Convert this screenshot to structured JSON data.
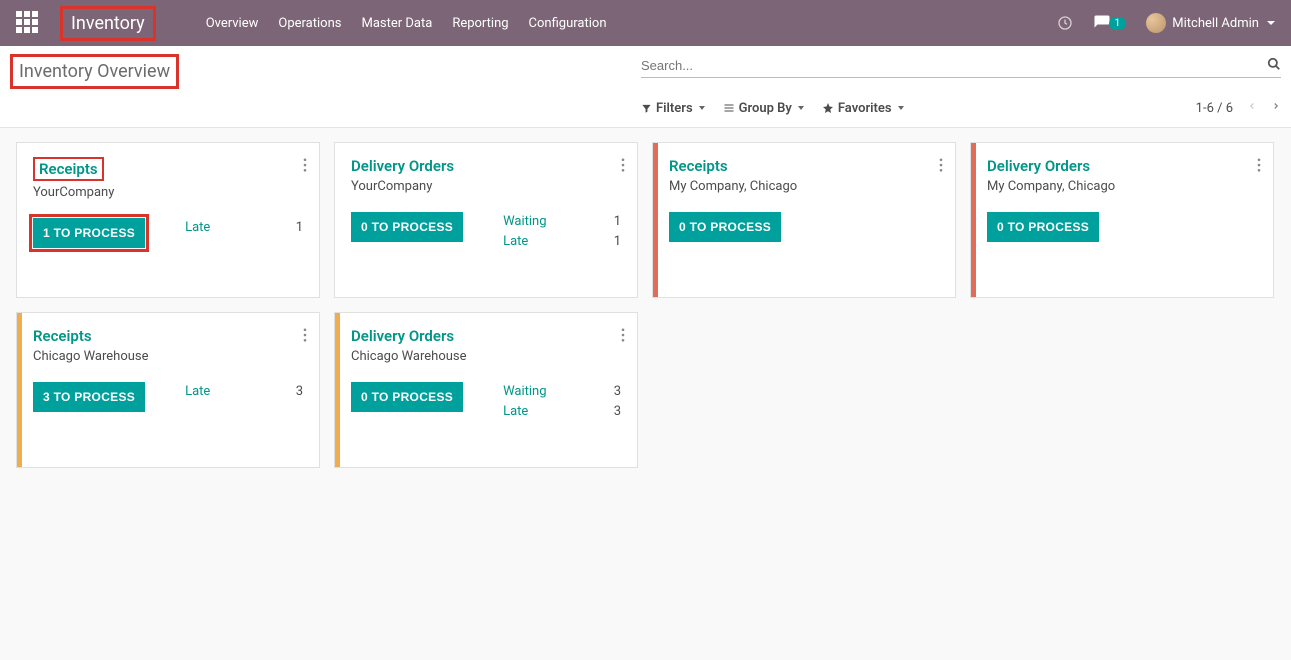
{
  "header": {
    "app_name": "Inventory",
    "nav": [
      "Overview",
      "Operations",
      "Master Data",
      "Reporting",
      "Configuration"
    ],
    "messages_badge": "1",
    "user_name": "Mitchell Admin"
  },
  "page": {
    "title": "Inventory Overview",
    "search_placeholder": "Search...",
    "filters_label": "Filters",
    "groupby_label": "Group By",
    "favorites_label": "Favorites",
    "pager": "1-6 / 6"
  },
  "cards": [
    {
      "title": "Receipts",
      "company": "YourCompany",
      "process": "1 TO PROCESS",
      "title_boxed": true,
      "btn_boxed": true,
      "accent": "",
      "statuses": [
        {
          "label": "Late",
          "count": "1"
        }
      ]
    },
    {
      "title": "Delivery Orders",
      "company": "YourCompany",
      "process": "0 TO PROCESS",
      "accent": "",
      "statuses": [
        {
          "label": "Waiting",
          "count": "1"
        },
        {
          "label": "Late",
          "count": "1"
        }
      ]
    },
    {
      "title": "Receipts",
      "company": "My Company, Chicago",
      "process": "0 TO PROCESS",
      "accent": "red",
      "statuses": []
    },
    {
      "title": "Delivery Orders",
      "company": "My Company, Chicago",
      "process": "0 TO PROCESS",
      "accent": "red",
      "statuses": []
    },
    {
      "title": "Receipts",
      "company": "Chicago Warehouse",
      "process": "3 TO PROCESS",
      "accent": "orange",
      "statuses": [
        {
          "label": "Late",
          "count": "3"
        }
      ]
    },
    {
      "title": "Delivery Orders",
      "company": "Chicago Warehouse",
      "process": "0 TO PROCESS",
      "accent": "orange",
      "statuses": [
        {
          "label": "Waiting",
          "count": "3"
        },
        {
          "label": "Late",
          "count": "3"
        }
      ]
    }
  ]
}
